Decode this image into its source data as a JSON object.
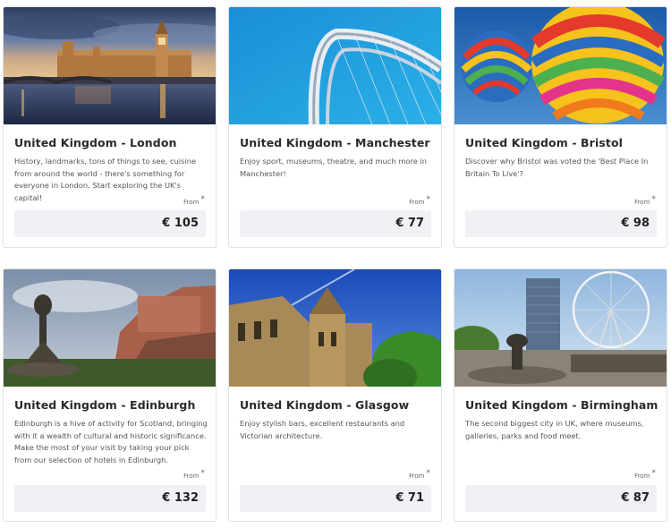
{
  "destinations": [
    {
      "title": "United Kingdom - London",
      "description": "History, landmarks, tons of things to see, cuisine from around the world - there's something for everyone in London. Start exploring the UK's capital!",
      "from_label": "From",
      "asterisk": "*",
      "price": "€ 105",
      "image": "london-westminster-photo"
    },
    {
      "title": "United Kingdom - Manchester",
      "description": "Enjoy sport, museums, theatre, and much more in Manchester!",
      "from_label": "From",
      "asterisk": "*",
      "price": "€ 77",
      "image": "manchester-bridge-photo"
    },
    {
      "title": "United Kingdom - Bristol",
      "description": "Discover why Bristol was voted the 'Best Place In Britain To Live'?",
      "from_label": "From",
      "asterisk": "*",
      "price": "€ 98",
      "image": "bristol-balloons-photo"
    },
    {
      "title": "United Kingdom - Edinburgh",
      "description": "Edinburgh is a hive of activity for Scotland, bringing with it a wealth of cultural and historic significance. Make the most of your visit by taking your pick from our selection of hotels in Edinburgh.",
      "from_label": "From",
      "asterisk": "*",
      "price": "€ 132",
      "image": "edinburgh-castle-photo"
    },
    {
      "title": "United Kingdom - Glasgow",
      "description": "Enjoy stylish bars, excellent restaurants and Victorian architecture.",
      "from_label": "From",
      "asterisk": "*",
      "price": "€ 71",
      "image": "glasgow-university-photo"
    },
    {
      "title": "United Kingdom - Birmingham",
      "description": "The second biggest city in UK, where museums, galleries, parks and food meet.",
      "from_label": "From",
      "asterisk": "*",
      "price": "€ 87",
      "image": "birmingham-wheel-photo"
    }
  ]
}
